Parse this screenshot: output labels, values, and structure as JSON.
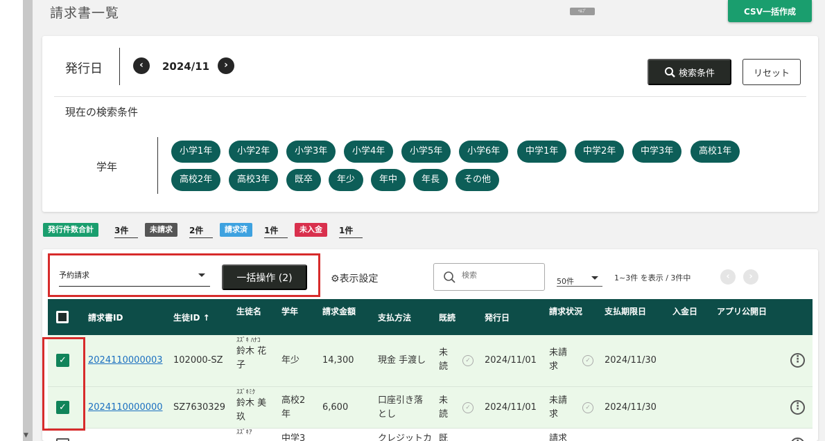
{
  "page": {
    "title": "請求書一覧",
    "mini_badge": "ﾍﾙﾌﾟ",
    "csv_button": "CSV一括作成"
  },
  "search": {
    "date_label": "発行日",
    "date_value": "2024/11",
    "prev_icon": "‹",
    "next_icon": "›",
    "search_button": "検索条件",
    "reset_button": "リセット",
    "current_conditions_label": "現在の検索条件",
    "grade_label": "学年",
    "grades": [
      "小学1年",
      "小学2年",
      "小学3年",
      "小学4年",
      "小学5年",
      "小学6年",
      "中学1年",
      "中学2年",
      "中学3年",
      "高校1年",
      "高校2年",
      "高校3年",
      "既卒",
      "年少",
      "年中",
      "年長",
      "その他"
    ]
  },
  "stats": [
    {
      "label": "発行件数合計",
      "count": "3件",
      "color": "#1a9e6e"
    },
    {
      "label": "未請求",
      "count": "2件",
      "color": "#555555"
    },
    {
      "label": "請求済",
      "count": "1件",
      "color": "#3ea2e0"
    },
    {
      "label": "未入金",
      "count": "1件",
      "color": "#d9304d"
    }
  ],
  "toolbar": {
    "bulk_select_value": "予約請求",
    "bulk_button": "一括操作 (2)",
    "display_settings": "表示設定",
    "search_placeholder": "検索",
    "per_page": "50件",
    "range_text": "1~3件 を表示 / 3件中"
  },
  "table": {
    "headers": [
      "請求書ID",
      "生徒ID ↑",
      "生徒名",
      "学年",
      "請求金額",
      "支払方法",
      "既読",
      "発行日",
      "請求状況",
      "支払期限日",
      "入金日",
      "アプリ公開日"
    ],
    "rows": [
      {
        "checked": true,
        "invoice_id": "2024110000003",
        "student_id": "102000-SZ",
        "kana": "ｽｽﾞｷ ﾊﾅｺ",
        "name": "鈴木 花子",
        "grade": "年少",
        "amount": "14,300",
        "payment": "現金 手渡し",
        "read": "未読",
        "issued": "2024/11/01",
        "status": "未請求",
        "due": "2024/11/30"
      },
      {
        "checked": true,
        "invoice_id": "2024110000000",
        "student_id": "SZ7630329",
        "kana": "ｽｽﾞｷﾐｸ",
        "name": "鈴木 美玖",
        "grade": "高校2年",
        "amount": "6,600",
        "payment": "口座引き落とし",
        "read": "未読",
        "issued": "2024/11/01",
        "status": "未請求",
        "due": "2024/11/30"
      },
      {
        "checked": false,
        "kana": "ｽｽﾞｷｱ",
        "grade": "中学3",
        "payment": "クレジットカ",
        "read": "既",
        "status": "請求"
      }
    ]
  }
}
